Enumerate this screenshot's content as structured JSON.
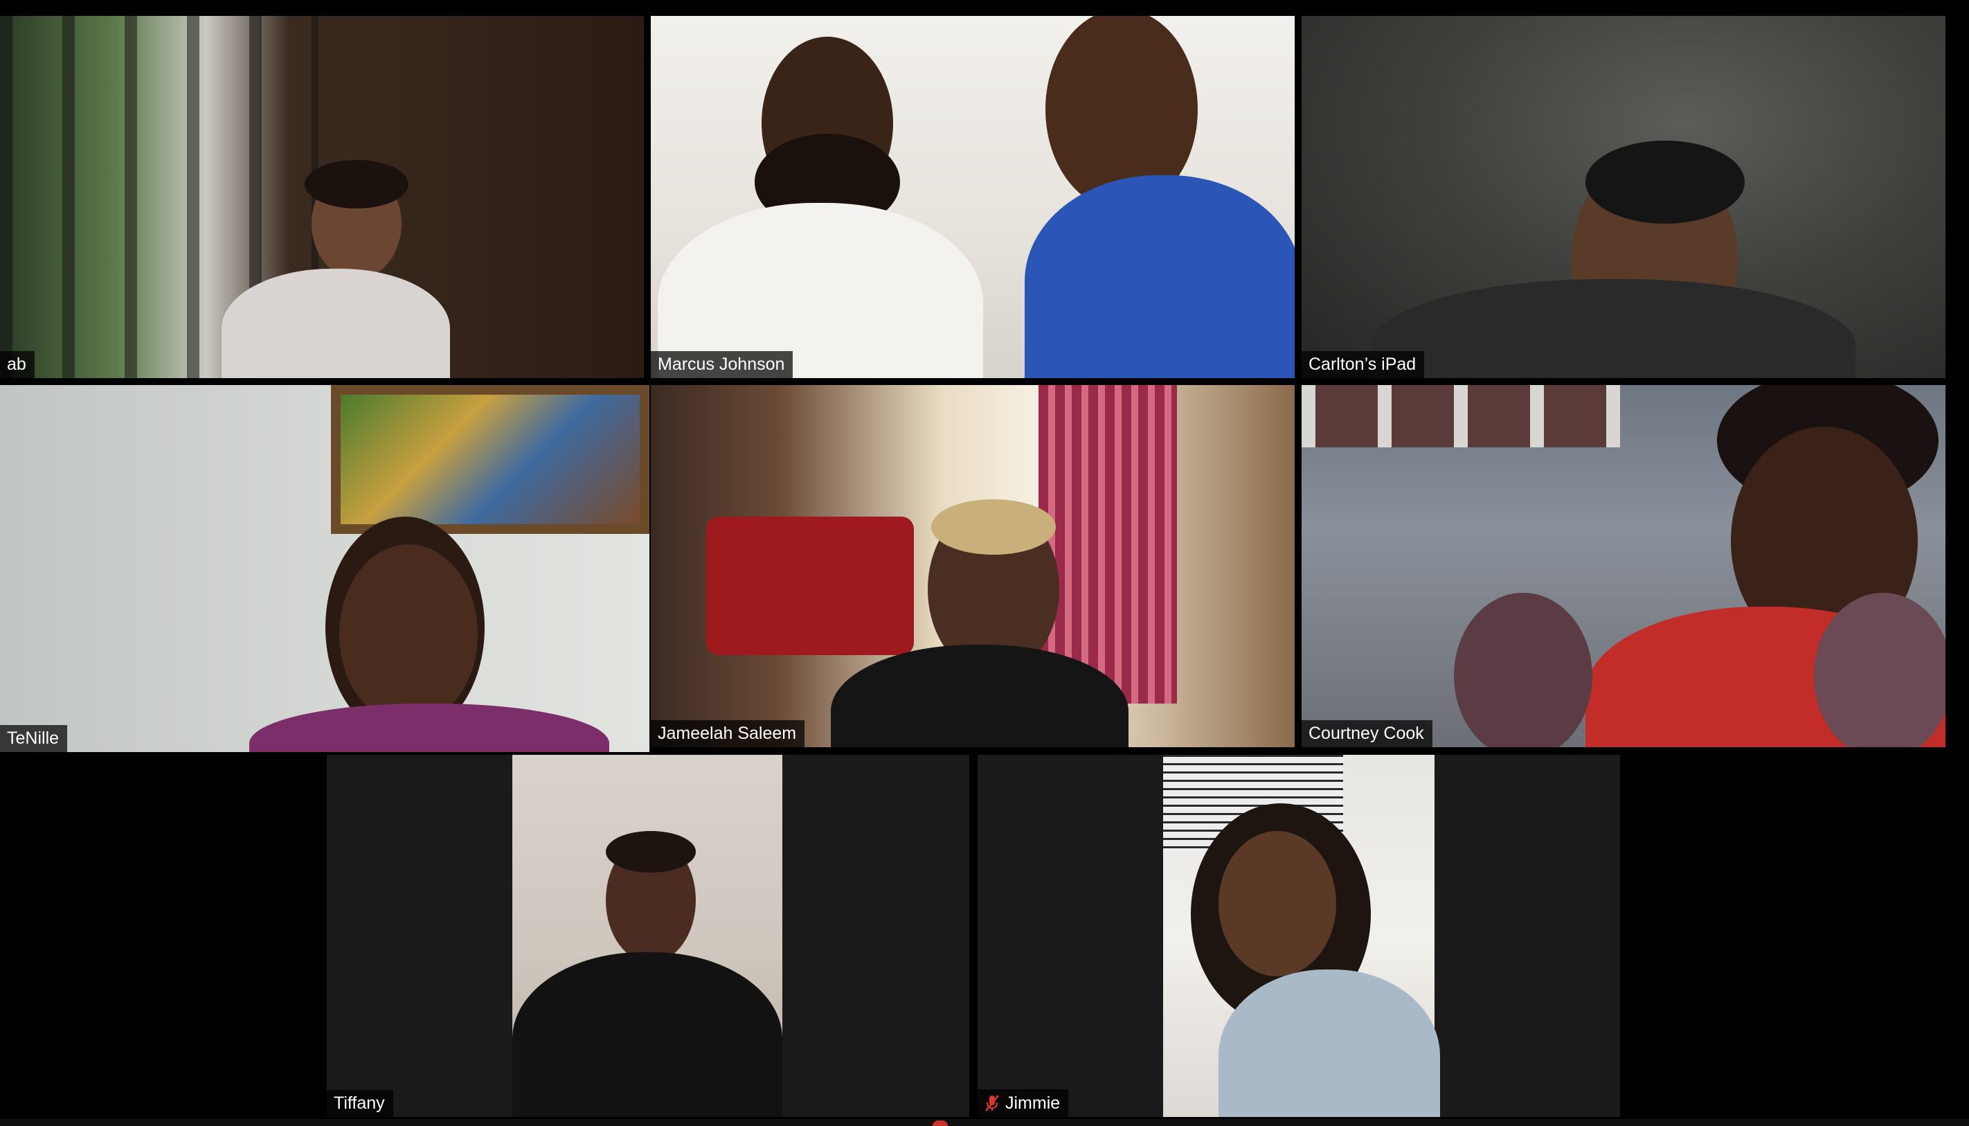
{
  "meeting": {
    "view": "gallery",
    "active_speaker": "TeNille",
    "accent_color": "#d6e79a"
  },
  "participants": [
    {
      "name": "ab",
      "muted": false
    },
    {
      "name": "Marcus Johnson",
      "muted": false
    },
    {
      "name": "Carlton’s iPad",
      "muted": false
    },
    {
      "name": "TeNille",
      "muted": false,
      "active": true
    },
    {
      "name": "Jameelah Saleem",
      "muted": false
    },
    {
      "name": "Courtney Cook",
      "muted": false
    },
    {
      "name": "Tiffany",
      "muted": false
    },
    {
      "name": "Jimmie",
      "muted": true,
      "mute_icon": "microphone-muted-icon",
      "mute_icon_color": "#e0352b"
    }
  ]
}
